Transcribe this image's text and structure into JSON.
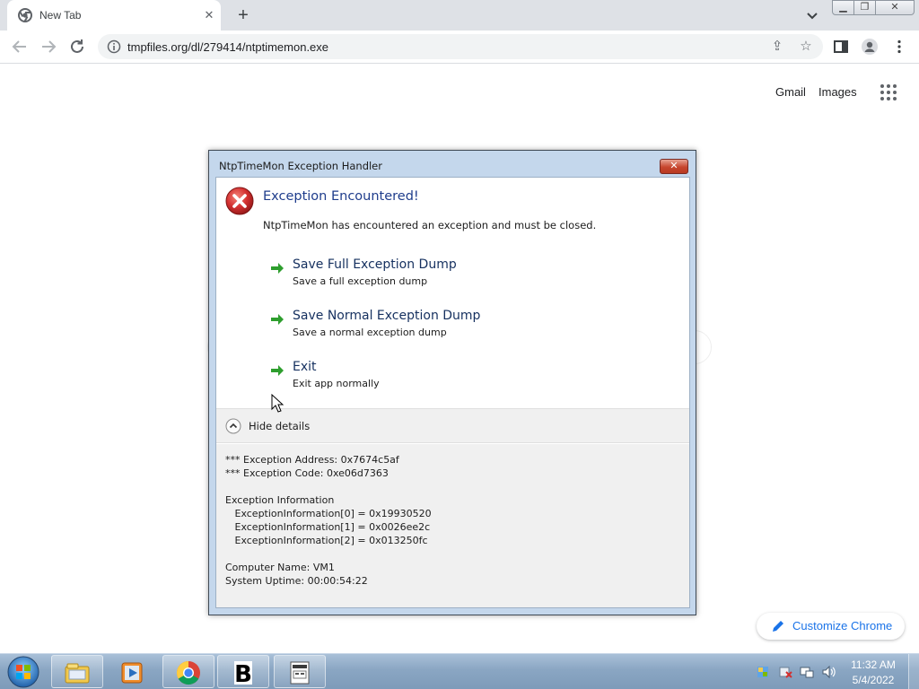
{
  "browser": {
    "tab_title": "New Tab",
    "url": "tmpfiles.org/dl/279414/ntptimemon.exe"
  },
  "ntp": {
    "gmail": "Gmail",
    "images": "Images",
    "customize": "Customize Chrome"
  },
  "dialog": {
    "title": "NtpTimeMon Exception Handler",
    "close_label": "✕",
    "heading": "Exception Encountered!",
    "message": "NtpTimeMon has encountered an exception and must be closed.",
    "commands": [
      {
        "label": "Save Full Exception Dump",
        "sub": "Save a full exception dump"
      },
      {
        "label": "Save Normal Exception Dump",
        "sub": "Save a normal exception dump"
      },
      {
        "label": "Exit",
        "sub": "Exit app normally"
      }
    ],
    "details_toggle": "Hide details",
    "details_text": "*** Exception Address: 0x7674c5af\n*** Exception Code: 0xe06d7363\n\nException Information\n   ExceptionInformation[0] = 0x19930520\n   ExceptionInformation[1] = 0x0026ee2c\n   ExceptionInformation[2] = 0x013250fc\n\nComputer Name: VM1\nSystem Uptime: 00:00:54:22"
  },
  "taskbar": {
    "time": "11:32 AM",
    "date": "5/4/2022",
    "apps": [
      "file-explorer-icon",
      "media-player-icon",
      "chrome-icon",
      "b-app-icon",
      "exception-handler-app-icon"
    ]
  },
  "colors": {
    "heading": "#1f3d8c",
    "link_blue": "#1a73e8",
    "error_red": "#c62828",
    "arrow_green": "#2e9e2e"
  }
}
